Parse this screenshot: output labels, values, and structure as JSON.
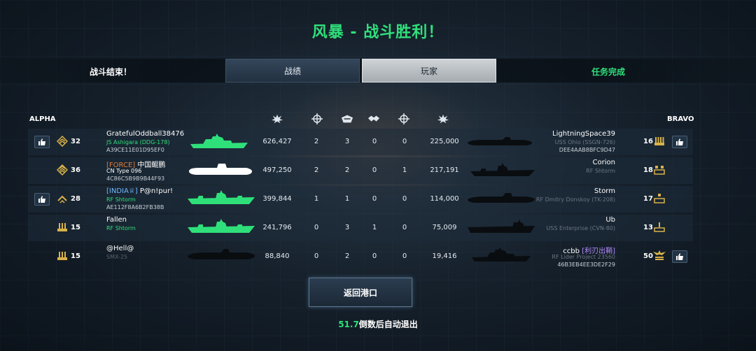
{
  "title": "风暴 - 战斗胜利！",
  "header": {
    "battle_over": "战斗结束！",
    "tab_stats": "战绩",
    "tab_players": "玩家",
    "mission_complete": "任务完成"
  },
  "teams": {
    "left": "ALPHA",
    "right": "BRAVO"
  },
  "columns": {
    "left_damage_icon": "damage-explosion-icon",
    "left_crosshair_icon": "crosshair-icon",
    "left_kills_icon": "kills-icon",
    "right_handshake_icon": "handshake-icon",
    "right_crosshair_icon": "crosshair-icon",
    "right_damage_icon": "damage-explosion-icon"
  },
  "left_players": [
    {
      "level": "32",
      "name": "GratefulOddball38476",
      "ship": "JS Ashigara (DDG-178)",
      "id": "A39CE11E01D95EF0",
      "damage": "626,427",
      "stat1": "2",
      "stat2": "3",
      "has_like": true
    },
    {
      "level": "36",
      "tag": "[FORCE]",
      "name": "中国鲲鹏",
      "ship": "CN Type 096",
      "id": "4C86C5B9B9B44F93",
      "damage": "497,250",
      "stat1": "2",
      "stat2": "2",
      "has_like": false
    },
    {
      "level": "28",
      "tag": "[INDIA♕]",
      "name": "P@n!pur!",
      "ship": "RF Shtorm",
      "id": "AE112F8A6B2FB38B",
      "damage": "399,844",
      "stat1": "1",
      "stat2": "1",
      "has_like": true
    },
    {
      "level": "15",
      "name": "Fallen",
      "ship": "RF Shtorm",
      "id": "",
      "damage": "241,796",
      "stat1": "0",
      "stat2": "3",
      "has_like": false
    },
    {
      "level": "15",
      "name": "@Hell@",
      "ship": "SMX-25",
      "id": "",
      "damage": "88,840",
      "stat1": "0",
      "stat2": "2",
      "has_like": false
    }
  ],
  "right_players": [
    {
      "level": "16",
      "name": "LightningSpace39",
      "ship": "USS Ohio (SSGN-726)",
      "id": "DEE4AAB8BFC9D47",
      "damage": "225,000",
      "stat1": "0",
      "stat2": "0",
      "has_like": true
    },
    {
      "level": "18",
      "name": "Corion",
      "ship": "RF Shtorm",
      "id": "",
      "damage": "217,191",
      "stat1": "0",
      "stat2": "1",
      "has_like": false
    },
    {
      "level": "17",
      "name": "Storm",
      "ship": "RF Dmitry Donskoy (TK-208)",
      "id": "",
      "damage": "114,000",
      "stat1": "0",
      "stat2": "0",
      "has_like": false
    },
    {
      "level": "13",
      "name": "Ub",
      "ship": "USS Enterprise (CVN-80)",
      "id": "",
      "damage": "75,009",
      "stat1": "1",
      "stat2": "0",
      "has_like": false
    },
    {
      "level": "50",
      "name": "ccbb",
      "tag": "[利刃出鞘]",
      "ship": "RF Lider Project 23560",
      "id": "46B3EB4EE3DE2F29",
      "damage": "19,416",
      "stat1": "0",
      "stat2": "0",
      "has_like": true
    }
  ],
  "footer": {
    "return_button": "返回港口",
    "countdown_value": "51.7",
    "countdown_text": "倒数后自动退出"
  },
  "colors": {
    "accent_green": "#2fe07a",
    "highlight_row": "#2a8a4a",
    "enemy_silhouette": "#0a0d10"
  }
}
